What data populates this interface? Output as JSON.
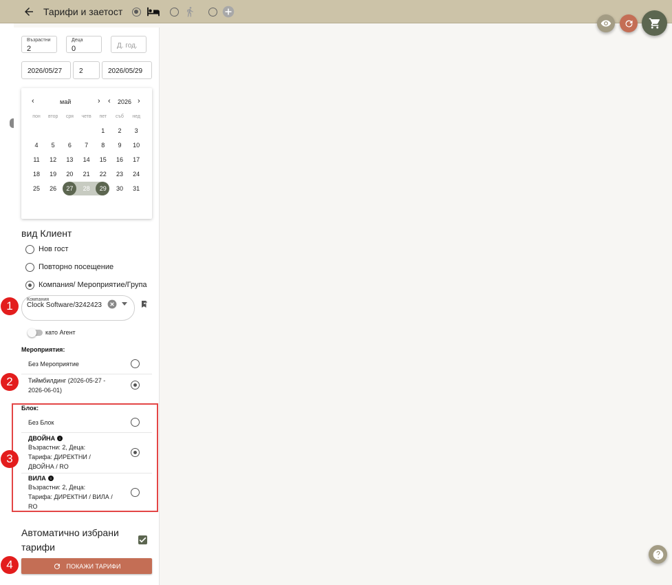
{
  "header": {
    "title": "Тарифи и заетост",
    "bg_color": "#ccc3a8",
    "mode_options": [
      {
        "icon": "bed-icon",
        "selected": true
      },
      {
        "icon": "walking-person-icon",
        "selected": false
      },
      {
        "icon": "add-circle-icon",
        "selected": false
      }
    ]
  },
  "fabs": {
    "eye_color": "#a39c84",
    "refresh_color": "#c46e55",
    "cart_color": "#5c6650"
  },
  "guests": {
    "adults_label": "Възрастни",
    "adults_value": "2",
    "children_label": "Деца",
    "children_value": "0",
    "birth_year_placeholder": "Д. год."
  },
  "dates": {
    "from": "2026/05/27",
    "nights": "2",
    "to": "2026/05/29"
  },
  "calendar": {
    "month": "май",
    "year": "2026",
    "prev_month": "‹",
    "next_month": "›",
    "prev_year": "‹",
    "next_year": "›",
    "weekdays": [
      "пон",
      "втор",
      "сря",
      "четв",
      "пет",
      "съб",
      "нед"
    ],
    "weeks": [
      [
        "",
        "",
        "",
        "",
        "1",
        "2",
        "3"
      ],
      [
        "4",
        "5",
        "6",
        "7",
        "8",
        "9",
        "10"
      ],
      [
        "11",
        "12",
        "13",
        "14",
        "15",
        "16",
        "17"
      ],
      [
        "18",
        "19",
        "20",
        "21",
        "22",
        "23",
        "24"
      ],
      [
        "25",
        "26",
        "27",
        "28",
        "29",
        "30",
        "31"
      ]
    ],
    "range_start": "27",
    "range_mid": "28",
    "range_end": "29",
    "selected_color": "#5c6650",
    "range_color": "#c7cbc1"
  },
  "client_type": {
    "title": "вид Клиент",
    "options": [
      {
        "label": "Нов гост",
        "selected": false
      },
      {
        "label": "Повторно посещение",
        "selected": false
      },
      {
        "label": "Компания/ Мероприятие/Група",
        "selected": true
      }
    ]
  },
  "company": {
    "label": "Компания",
    "value": "Clock Software/3242423"
  },
  "agent_toggle_label": "като Агент",
  "events": {
    "title": "Мероприятия:",
    "items": [
      {
        "label": "Без Мероприятие",
        "selected": false
      },
      {
        "label_line1": "Тиймбилдинг (2026-05-27 -",
        "label_line2": "2026-06-01)",
        "selected": true
      }
    ]
  },
  "blocks": {
    "title": "Блок:",
    "none_label": "Без Блок",
    "items": [
      {
        "name": "ДВОЙНА",
        "line1": "Възрастни: 2, Деца:",
        "line2": "Тарифа: ДИРЕКТНИ /",
        "line3": "ДВОЙНА / RO",
        "selected": true
      },
      {
        "name": "ВИЛА",
        "line1": "Възрастни: 2, Деца:",
        "line2": "Тарифа: ДИРЕКТНИ / ВИЛА /",
        "line3": "RO",
        "selected": false
      }
    ]
  },
  "auto_tariffs": {
    "line1": "Автоматично избрани",
    "line2": "тарифи",
    "checked": true
  },
  "show_button_label": "ПОКАЖИ ТАРИФИ",
  "markers": [
    "1",
    "2",
    "3",
    "4"
  ],
  "help_icon": "question-icon",
  "marker_color": "#e31d1d"
}
